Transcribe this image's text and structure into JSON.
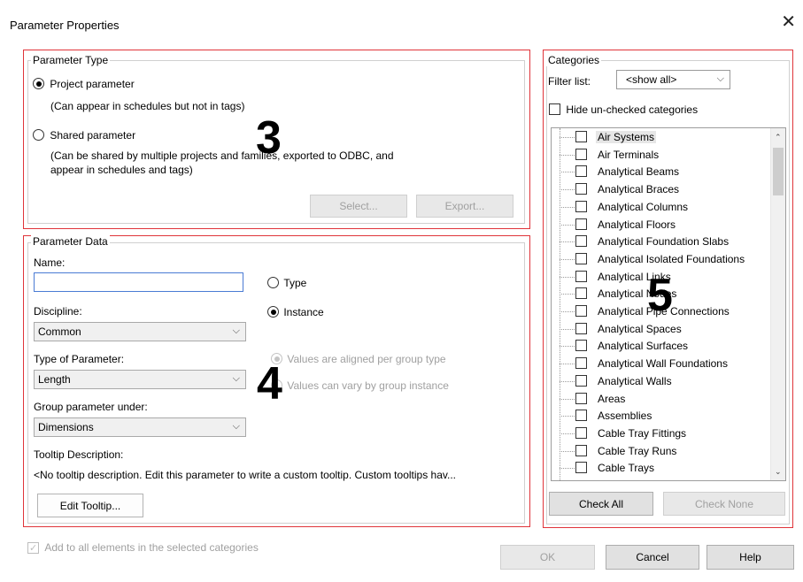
{
  "window": {
    "title": "Parameter Properties",
    "close_glyph": "✕"
  },
  "parameter_type": {
    "legend": "Parameter Type",
    "project_label": "Project parameter",
    "project_desc": "(Can appear in schedules but not in tags)",
    "shared_label": "Shared parameter",
    "shared_desc_1": "(Can be shared by multiple projects and families, exported to ODBC, and",
    "shared_desc_2": "appear in schedules and tags)",
    "select_button": "Select...",
    "export_button": "Export...",
    "selected": "project"
  },
  "parameter_data": {
    "legend": "Parameter Data",
    "name_label": "Name:",
    "name_value": "",
    "discipline_label": "Discipline:",
    "discipline_value": "Common",
    "type_of_parameter_label": "Type of Parameter:",
    "type_of_parameter_value": "Length",
    "group_label": "Group parameter under:",
    "group_value": "Dimensions",
    "tooltip_label": "Tooltip Description:",
    "tooltip_text": "<No tooltip description. Edit this parameter to write a custom tooltip. Custom tooltips hav...",
    "edit_tooltip_button": "Edit Tooltip...",
    "type_radio": "Type",
    "instance_radio": "Instance",
    "aligned_radio": "Values are aligned per group type",
    "vary_radio": "Values can vary by group instance",
    "selected": "instance"
  },
  "categories": {
    "legend": "Categories",
    "filter_label": "Filter list:",
    "filter_value": "<show all>",
    "hide_label": "Hide un-checked categories",
    "items": [
      "Air Systems",
      "Air Terminals",
      "Analytical Beams",
      "Analytical Braces",
      "Analytical Columns",
      "Analytical Floors",
      "Analytical Foundation Slabs",
      "Analytical Isolated Foundations",
      "Analytical Links",
      "Analytical Nodes",
      "Analytical Pipe Connections",
      "Analytical Spaces",
      "Analytical Surfaces",
      "Analytical Wall Foundations",
      "Analytical Walls",
      "Areas",
      "Assemblies",
      "Cable Tray Fittings",
      "Cable Tray Runs",
      "Cable Trays"
    ],
    "check_all_button": "Check All",
    "check_none_button": "Check None"
  },
  "footer": {
    "add_to_all_label": "Add to all elements in the selected categories",
    "ok_button": "OK",
    "cancel_button": "Cancel",
    "help_button": "Help"
  },
  "annotations": {
    "n3": "3",
    "n4": "4",
    "n5": "5"
  },
  "colors": {
    "annotation_red": "#e0343a",
    "selection_gray": "#e6e6e6"
  }
}
